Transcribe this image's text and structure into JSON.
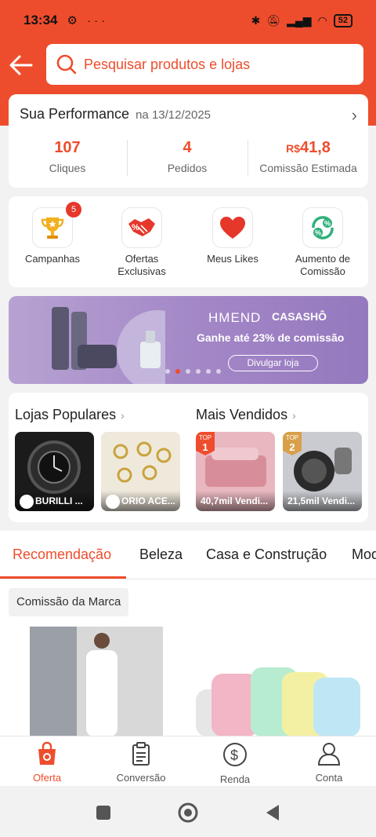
{
  "status": {
    "time": "13:34",
    "battery": "52"
  },
  "search": {
    "placeholder": "Pesquisar produtos e lojas"
  },
  "performance": {
    "title": "Sua Performance",
    "date": "na 13/12/2025",
    "metrics": [
      {
        "value": "107",
        "label": "Cliques"
      },
      {
        "value": "4",
        "label": "Pedidos"
      },
      {
        "currency": "R$",
        "value": "41,8",
        "label": "Comissão Estimada"
      }
    ]
  },
  "shortcuts": [
    {
      "label": "Campanhas",
      "badge": "5",
      "icon": "trophy-icon"
    },
    {
      "label": "Ofertas\nExclusivas",
      "icon": "handshake-icon"
    },
    {
      "label": "Meus Likes",
      "icon": "heart-icon"
    },
    {
      "label": "Aumento de\nComissão",
      "icon": "percent-cycle-icon"
    }
  ],
  "banner": {
    "brand1": "HMEND",
    "brand2": "CASASHÔ",
    "headline": "Ganhe até 23% de comissão",
    "cta": "Divulgar loja",
    "active_slide": 2,
    "slides": 6
  },
  "popular_stores": {
    "title": "Lojas Populares",
    "items": [
      {
        "name": "BURILLI ..."
      },
      {
        "name": "ORIO ACE..."
      }
    ]
  },
  "best_sellers": {
    "title": "Mais Vendidos",
    "items": [
      {
        "rank_label": "TOP",
        "rank": "1",
        "sales": "40,7mil Vendi..."
      },
      {
        "rank_label": "TOP",
        "rank": "2",
        "sales": "21,5mil Vendi..."
      }
    ]
  },
  "tabs": [
    "Recomendação",
    "Beleza",
    "Casa e Construção",
    "Mod"
  ],
  "feed": {
    "chip": "Comissão da Marca"
  },
  "bottom_nav": [
    {
      "label": "Oferta",
      "icon": "shopping-bag-icon",
      "active": true
    },
    {
      "label": "Conversão",
      "icon": "clipboard-icon"
    },
    {
      "label": "Renda",
      "icon": "dollar-icon"
    },
    {
      "label": "Conta",
      "icon": "user-icon"
    }
  ],
  "colors": {
    "primary": "#ee4d2d",
    "banner": "#a286c6"
  }
}
